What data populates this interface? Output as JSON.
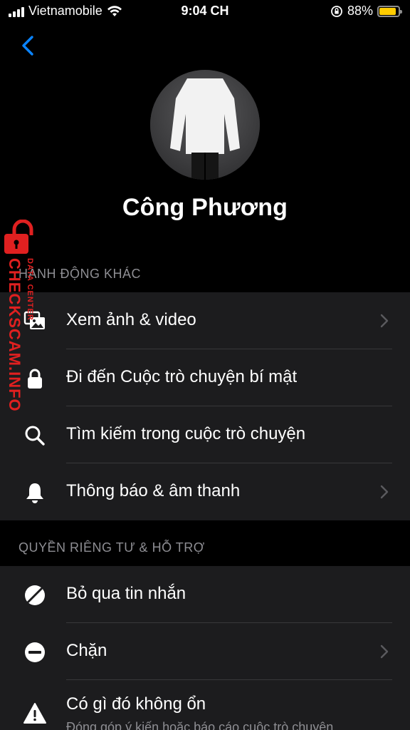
{
  "status_bar": {
    "carrier": "Vietnamobile",
    "time": "9:04 CH",
    "battery_percent": "88%",
    "battery_level": 0.88,
    "battery_color": "#ffcc00"
  },
  "profile": {
    "name": "Công Phương"
  },
  "sections": {
    "actions_header": "HÀNH ĐỘNG KHÁC",
    "privacy_header": "QUYỀN RIÊNG TƯ & HỖ TRỢ"
  },
  "actions": [
    {
      "label": "Xem ảnh & video",
      "icon": "photos-icon"
    },
    {
      "label": "Đi đến Cuộc trò chuyện bí mật",
      "icon": "lock-icon"
    },
    {
      "label": "Tìm kiếm trong cuộc trò chuyện",
      "icon": "search-icon"
    },
    {
      "label": "Thông báo & âm thanh",
      "icon": "bell-icon"
    }
  ],
  "privacy": [
    {
      "label": "Bỏ qua tin nhắn",
      "icon": "ignore-icon"
    },
    {
      "label": "Chặn",
      "icon": "block-icon"
    },
    {
      "label": "Có gì đó không ổn",
      "sublabel": "Đóng góp ý kiến hoặc báo cáo cuộc trò chuyện",
      "icon": "warning-icon"
    }
  ],
  "watermark": {
    "text": "CHECKSCAM.INFO",
    "subtext": "DATA CENTER",
    "color": "#e02020"
  },
  "colors": {
    "accent": "#0a84ff",
    "background": "#000000",
    "group_background": "#1c1c1e",
    "secondary_text": "#8e8e93"
  }
}
